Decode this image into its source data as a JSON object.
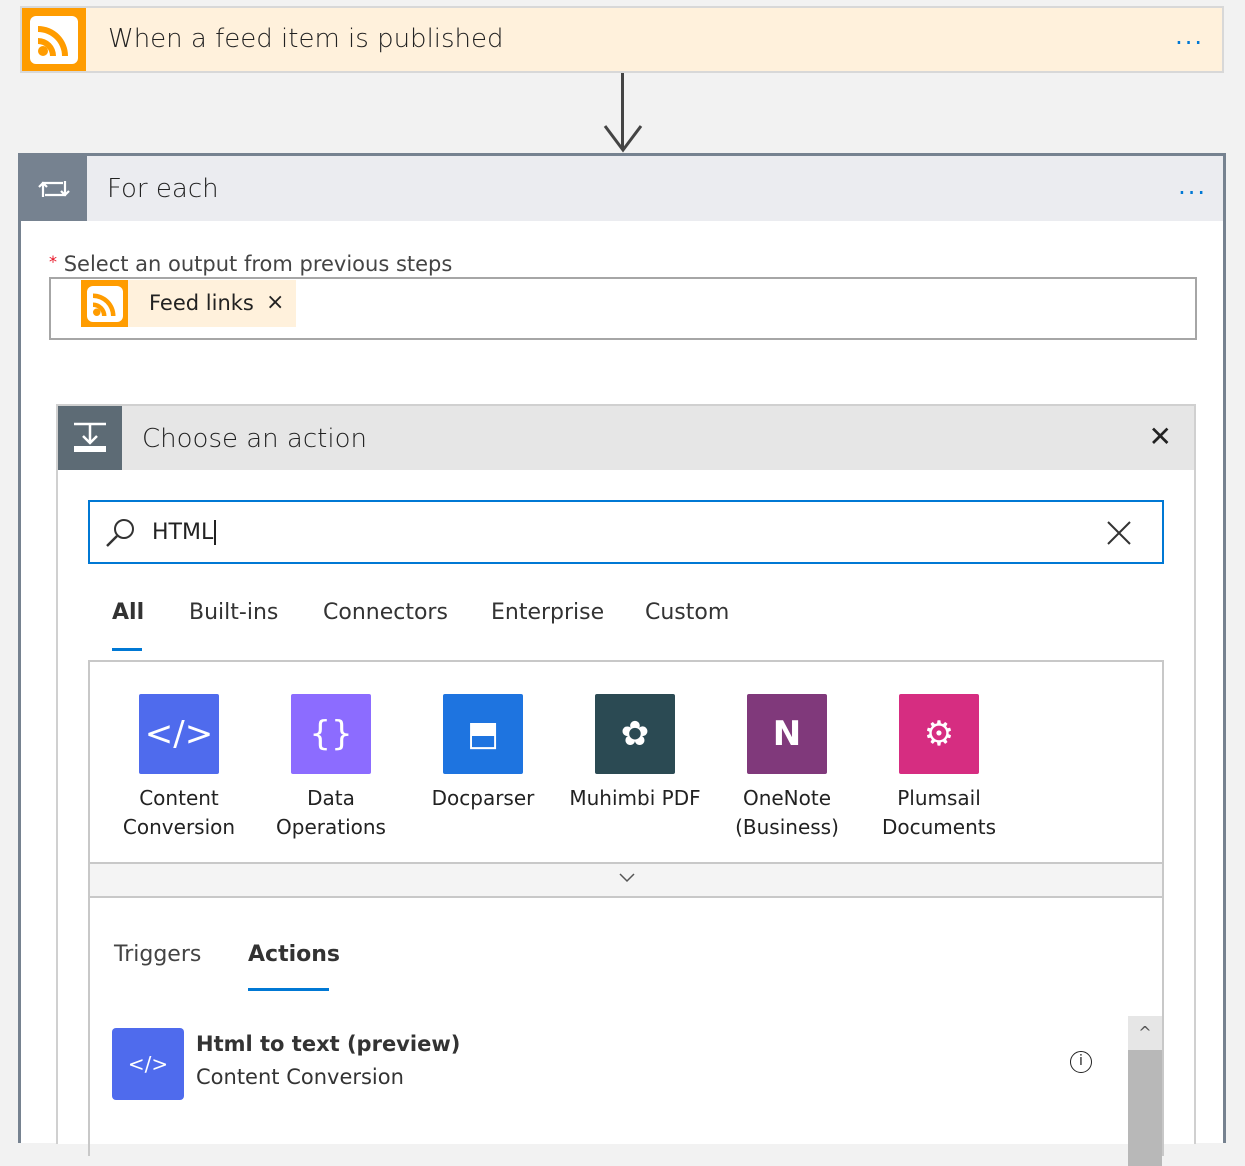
{
  "trigger": {
    "title": "When a feed item is published",
    "more": "...",
    "icon": "rss-icon",
    "color": "#ff9c00"
  },
  "foreach": {
    "title": "For each",
    "more": "...",
    "icon": "loop-icon",
    "field_label": "Select an output from previous steps",
    "required": "*",
    "token": "Feed links",
    "token_remove": "×"
  },
  "choose": {
    "title": "Choose an action",
    "close": "✕",
    "search_value": "HTML",
    "tabs": [
      {
        "label": "All",
        "active": true
      },
      {
        "label": "Built-ins"
      },
      {
        "label": "Connectors"
      },
      {
        "label": "Enterprise"
      },
      {
        "label": "Custom"
      }
    ],
    "connectors": [
      {
        "name": "Content Conversion",
        "line1": "Content",
        "line2": "Conversion",
        "color": "#4f6bed",
        "icon": "content-conversion-icon"
      },
      {
        "name": "Data Operations",
        "line1": "Data",
        "line2": "Operations",
        "color": "#8c6cff",
        "icon": "data-operations-icon"
      },
      {
        "name": "Docparser",
        "line1": "Docparser",
        "line2": "",
        "color": "#1e74e0",
        "icon": "docparser-icon"
      },
      {
        "name": "Muhimbi PDF",
        "line1": "Muhimbi PDF",
        "line2": "",
        "color": "#2b4a53",
        "icon": "muhimbi-icon"
      },
      {
        "name": "OneNote (Business)",
        "line1": "OneNote",
        "line2": "(Business)",
        "color": "#80397b",
        "icon": "onenote-icon"
      },
      {
        "name": "Plumsail Documents",
        "line1": "Plumsail",
        "line2": "Documents",
        "color": "#d62d81",
        "icon": "plumsail-icon"
      }
    ],
    "subtabs": [
      {
        "label": "Triggers"
      },
      {
        "label": "Actions",
        "active": true
      }
    ],
    "actions": [
      {
        "title": "Html to text (preview)",
        "subtitle": "Content Conversion",
        "color": "#4f6bed"
      }
    ],
    "accent": "#0078d4"
  }
}
